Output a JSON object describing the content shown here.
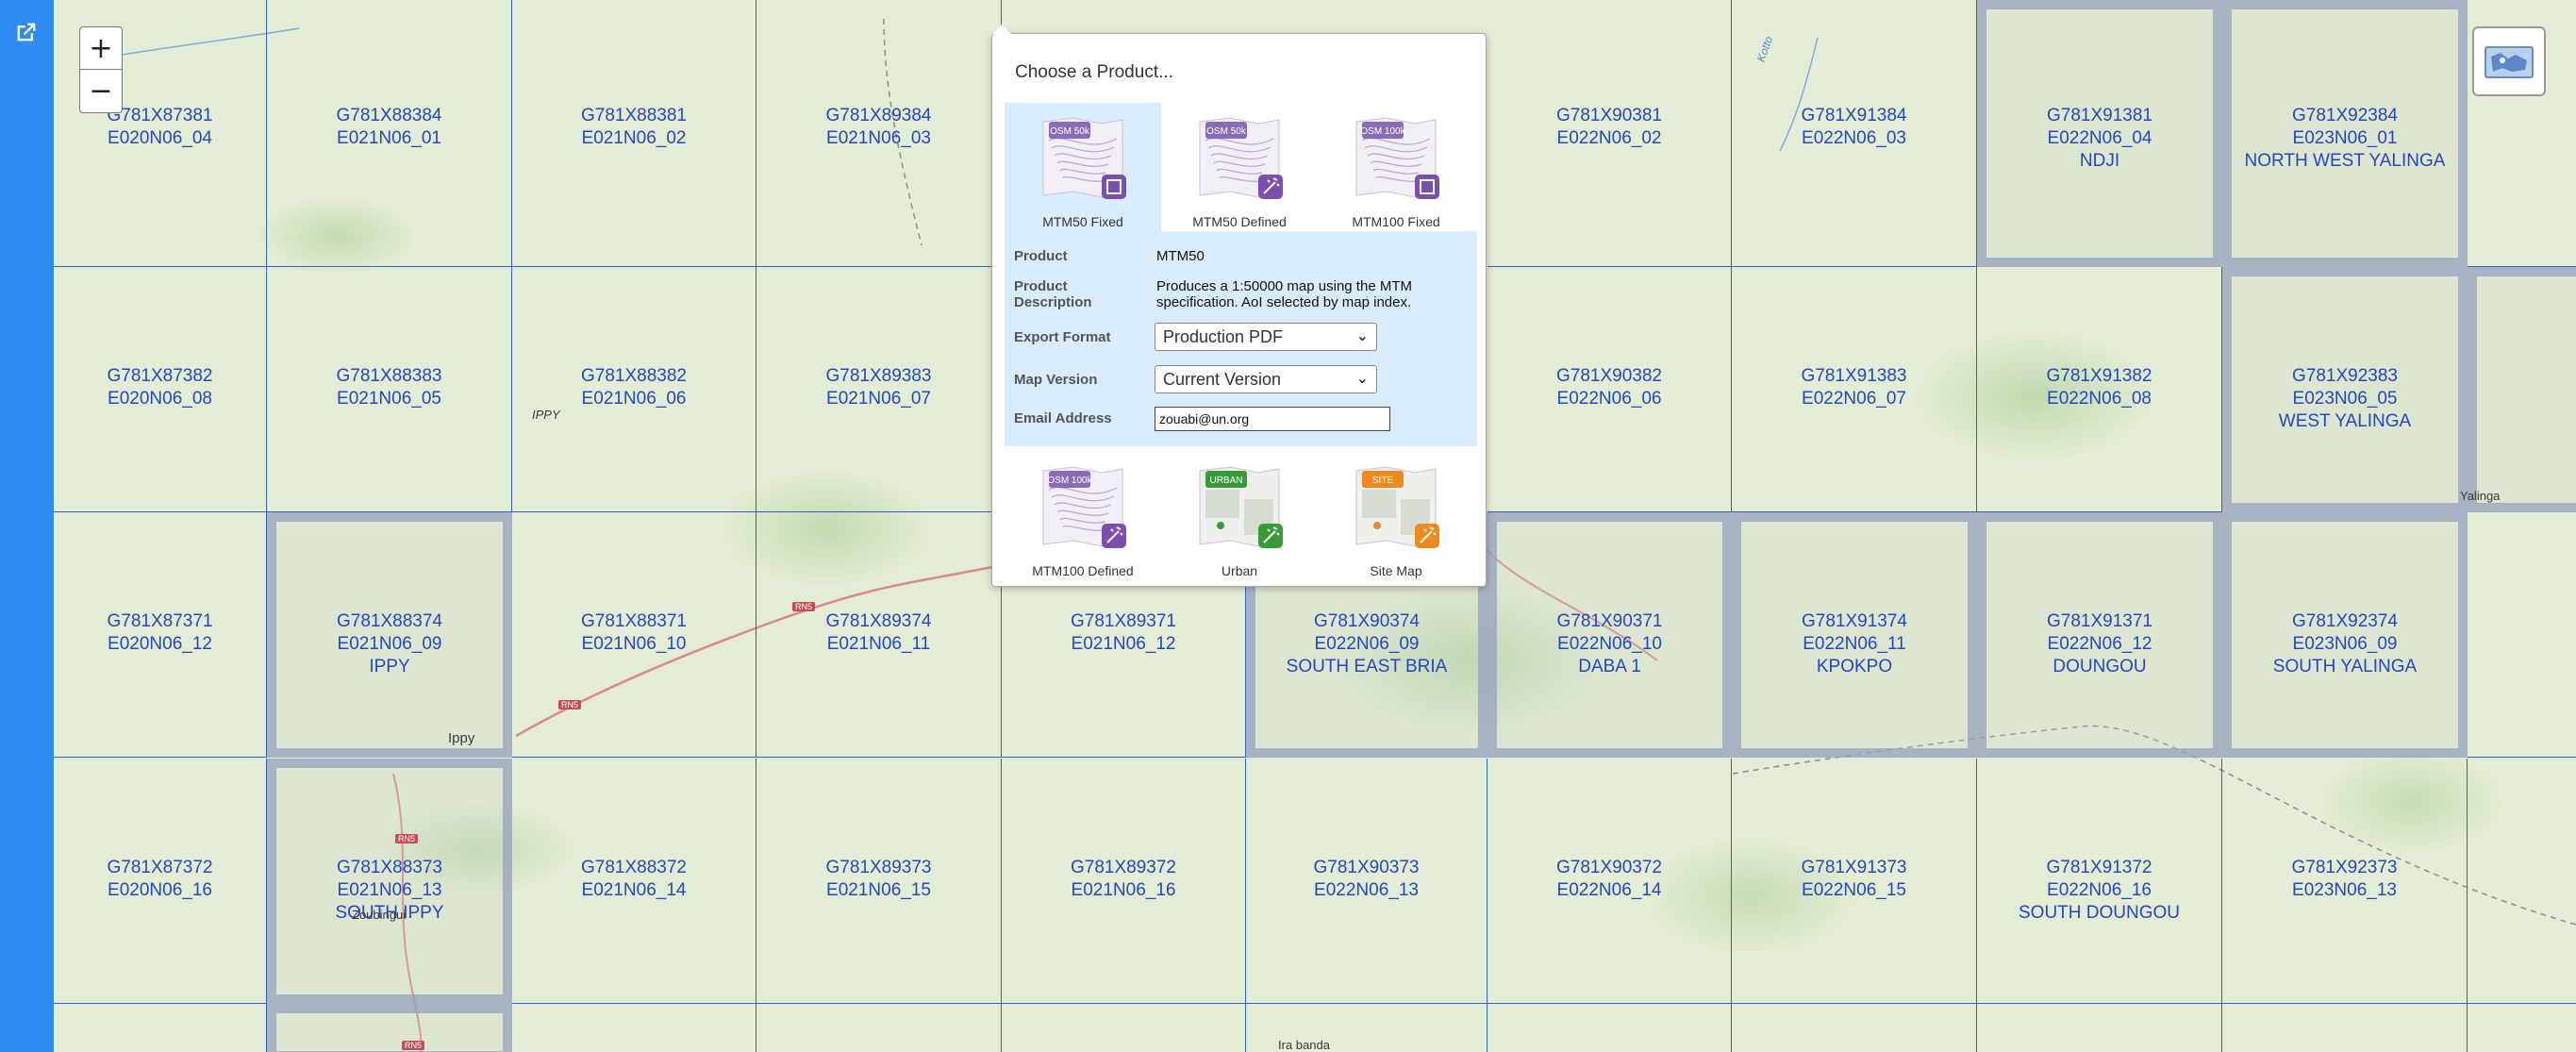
{
  "sidebar": {
    "open_icon": "external-link-icon"
  },
  "map_controls": {
    "zoom_in": "+",
    "zoom_out": "−",
    "layers_icon": "map-layers-icon"
  },
  "tiles": [
    {
      "code": "G781X87381",
      "sheet": "E020N06_04",
      "name": ""
    },
    {
      "code": "G781X88384",
      "sheet": "E021N06_01",
      "name": ""
    },
    {
      "code": "G781X88381",
      "sheet": "E021N06_02",
      "name": ""
    },
    {
      "code": "G781X89384",
      "sheet": "E021N06_03",
      "name": ""
    },
    {
      "code": "G781X90381",
      "sheet": "E022N06_02",
      "name": ""
    },
    {
      "code": "G781X91384",
      "sheet": "E022N06_03",
      "name": ""
    },
    {
      "code": "G781X91381",
      "sheet": "E022N06_04",
      "name": "NDJI"
    },
    {
      "code": "G781X92384",
      "sheet": "E023N06_01",
      "name": "NORTH WEST YALINGA"
    },
    {
      "code": "G781X87382",
      "sheet": "E020N06_08",
      "name": ""
    },
    {
      "code": "G781X88383",
      "sheet": "E021N06_05",
      "name": ""
    },
    {
      "code": "G781X88382",
      "sheet": "E021N06_06",
      "name": ""
    },
    {
      "code": "G781X89383",
      "sheet": "E021N06_07",
      "name": ""
    },
    {
      "code": "G781X90382",
      "sheet": "E022N06_06",
      "name": ""
    },
    {
      "code": "G781X91383",
      "sheet": "E022N06_07",
      "name": ""
    },
    {
      "code": "G781X91382",
      "sheet": "E022N06_08",
      "name": ""
    },
    {
      "code": "G781X92383",
      "sheet": "E023N06_05",
      "name": "WEST YALINGA"
    },
    {
      "code": "G781X87371",
      "sheet": "E020N06_12",
      "name": ""
    },
    {
      "code": "G781X88374",
      "sheet": "E021N06_09",
      "name": "IPPY"
    },
    {
      "code": "G781X88371",
      "sheet": "E021N06_10",
      "name": ""
    },
    {
      "code": "G781X89374",
      "sheet": "E021N06_11",
      "name": ""
    },
    {
      "code": "G781X89371",
      "sheet": "E021N06_12",
      "name": ""
    },
    {
      "code": "G781X90374",
      "sheet": "E022N06_09",
      "name": "SOUTH EAST BRIA"
    },
    {
      "code": "G781X90371",
      "sheet": "E022N06_10",
      "name": "DABA 1"
    },
    {
      "code": "G781X91374",
      "sheet": "E022N06_11",
      "name": "KPOKPO"
    },
    {
      "code": "G781X91371",
      "sheet": "E022N06_12",
      "name": "DOUNGOU"
    },
    {
      "code": "G781X92374",
      "sheet": "E023N06_09",
      "name": "SOUTH YALINGA"
    },
    {
      "code": "G781X87372",
      "sheet": "E020N06_16",
      "name": ""
    },
    {
      "code": "G781X88373",
      "sheet": "E021N06_13",
      "name": "SOUTH IPPY"
    },
    {
      "code": "G781X88372",
      "sheet": "E021N06_14",
      "name": ""
    },
    {
      "code": "G781X89373",
      "sheet": "E021N06_15",
      "name": ""
    },
    {
      "code": "G781X89372",
      "sheet": "E021N06_16",
      "name": ""
    },
    {
      "code": "G781X90373",
      "sheet": "E022N06_13",
      "name": ""
    },
    {
      "code": "G781X90372",
      "sheet": "E022N06_14",
      "name": ""
    },
    {
      "code": "G781X91373",
      "sheet": "E022N06_15",
      "name": ""
    },
    {
      "code": "G781X91372",
      "sheet": "E022N06_16",
      "name": "SOUTH DOUNGOU"
    },
    {
      "code": "G781X92373",
      "sheet": "E023N06_13",
      "name": ""
    }
  ],
  "places": [
    "IPPY",
    "Ippy",
    "Zoubingui",
    "Ira banda",
    "Yalinga",
    "Kotto"
  ],
  "road_refs": [
    "RN5",
    "RN5",
    "RN5",
    "RN5"
  ],
  "popup": {
    "title": "Choose a Product...",
    "top_products": [
      {
        "badge": "OSM 50k",
        "name": "MTM50 Fixed",
        "badge_color": "#8a6bb5",
        "action_color": "#7b4fb0",
        "action_icon": "square-select-icon"
      },
      {
        "badge": "OSM 50k",
        "name": "MTM50 Defined",
        "badge_color": "#8a6bb5",
        "action_color": "#7b4fb0",
        "action_icon": "magic-wand-icon"
      },
      {
        "badge": "OSM 100k",
        "name": "MTM100 Fixed",
        "badge_color": "#8a6bb5",
        "action_color": "#7b4fb0",
        "action_icon": "square-select-icon"
      }
    ],
    "bottom_products": [
      {
        "badge": "OSM 100k",
        "name": "MTM100 Defined",
        "badge_color": "#8a6bb5",
        "action_color": "#7b4fb0",
        "action_icon": "magic-wand-icon"
      },
      {
        "badge": "URBAN",
        "name": "Urban",
        "badge_color": "#3a9a3a",
        "action_color": "#3a9a3a",
        "action_icon": "magic-wand-icon"
      },
      {
        "badge": "SITE",
        "name": "Site Map",
        "badge_color": "#f08a20",
        "action_color": "#f08a20",
        "action_icon": "magic-wand-icon"
      }
    ],
    "details": {
      "product_label": "Product",
      "product_value": "MTM50",
      "desc_label_1": "Product",
      "desc_label_2": "Description",
      "desc_line_1": "Produces a 1:50000 map using the MTM",
      "desc_line_2": "specification. AoI selected by map index.",
      "export_label": "Export Format",
      "export_value": "Production PDF",
      "version_label": "Map Version",
      "version_value": "Current Version",
      "email_label": "Email Address",
      "email_value": "zouabi@un.org"
    }
  }
}
